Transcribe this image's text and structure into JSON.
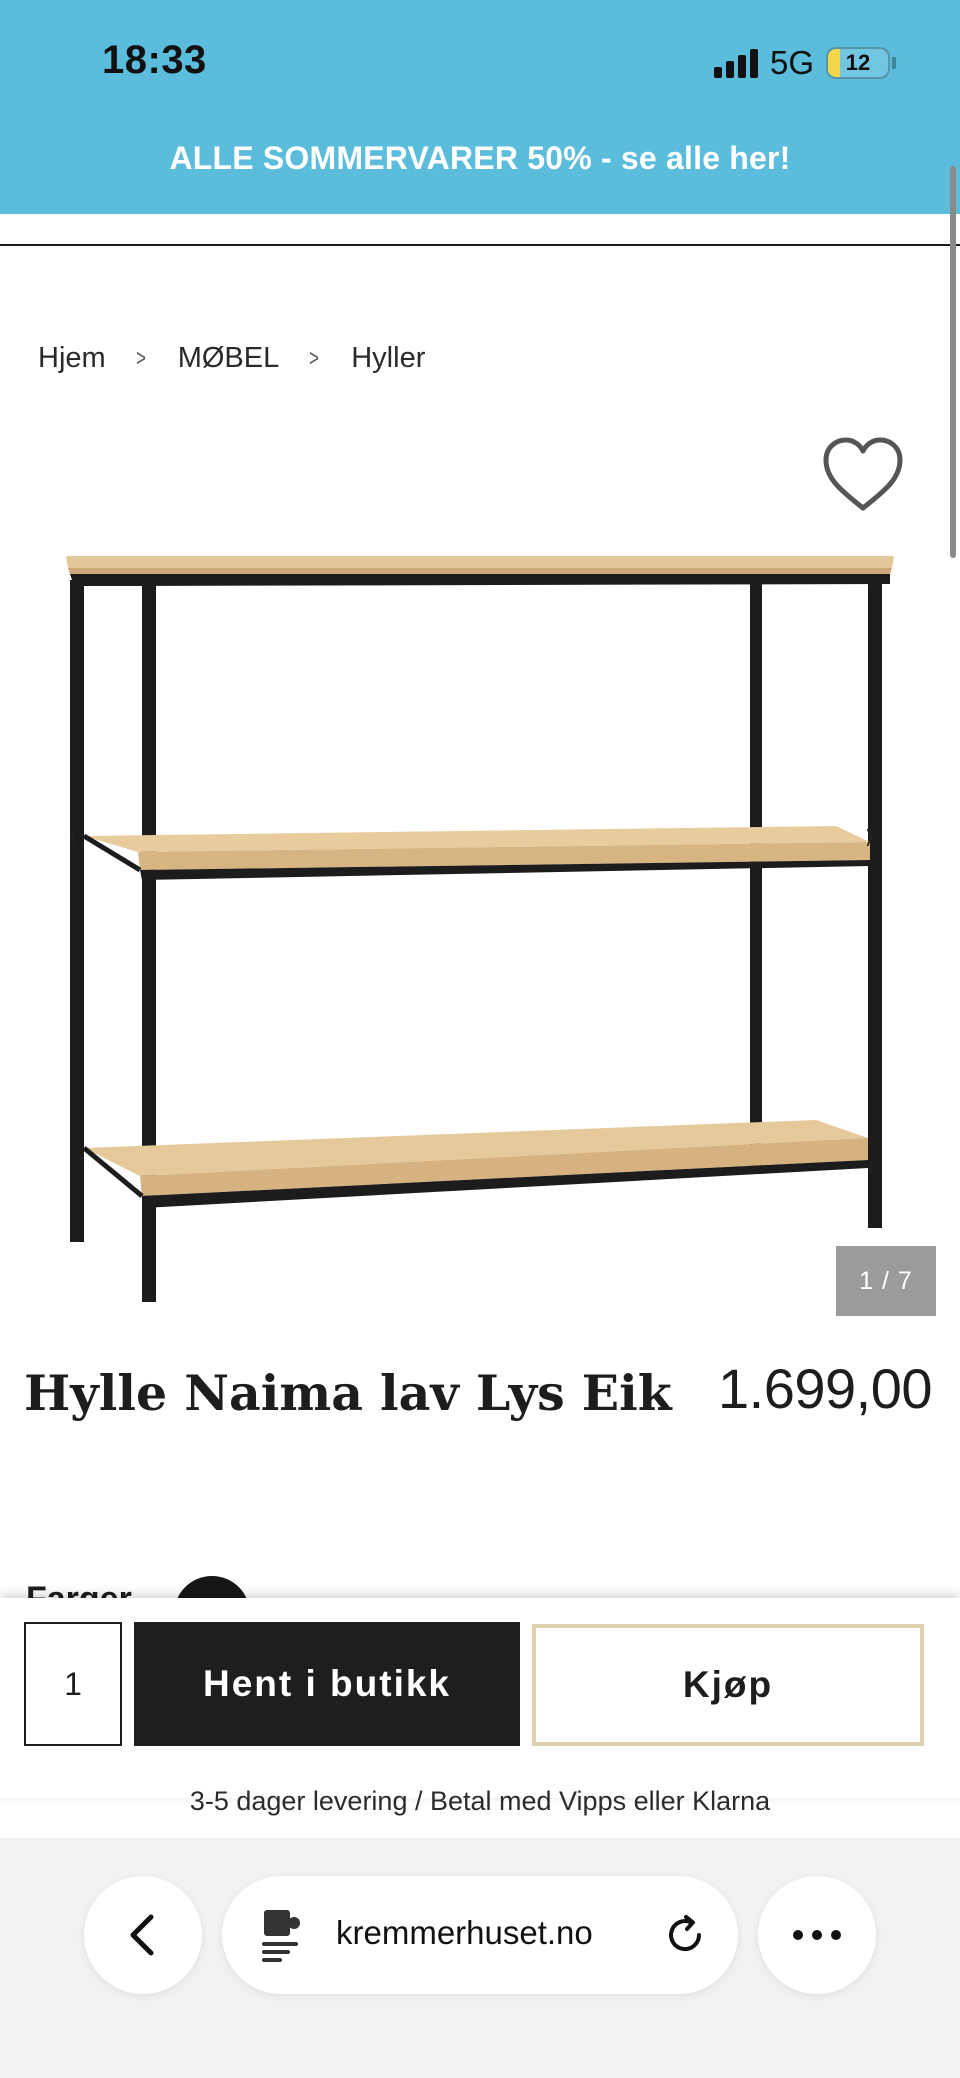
{
  "status_bar": {
    "time": "18:33",
    "network": "5G",
    "battery": "12",
    "battery_level": 0.12
  },
  "promo_banner": {
    "text": "ALLE SOMMERVARER 50% - se alle her!"
  },
  "breadcrumb": [
    {
      "label": "Hjem"
    },
    {
      "label": "MØBEL"
    },
    {
      "label": "Hyller"
    }
  ],
  "gallery": {
    "counter": "1 / 7",
    "current": 1,
    "total": 7,
    "prev_glyph": "‹",
    "next_glyph": "›"
  },
  "product": {
    "title": "Hylle Naima lav Lys Eik",
    "price": "1.699,00"
  },
  "options": {
    "colors_label": "Farger"
  },
  "buy_bar": {
    "quantity": "1",
    "store_button": "Hent i butikk",
    "buy_button": "Kjøp",
    "delivery_note": "3-5 dager levering / Betal med Vipps eller Klarna"
  },
  "browser": {
    "domain": "kremmerhuset.no"
  },
  "colors": {
    "banner": "#5bbcdc",
    "store_button": "#1e1e1e",
    "buy_border": "#ddd0ad",
    "counter_bg": "#9b9b9b"
  }
}
